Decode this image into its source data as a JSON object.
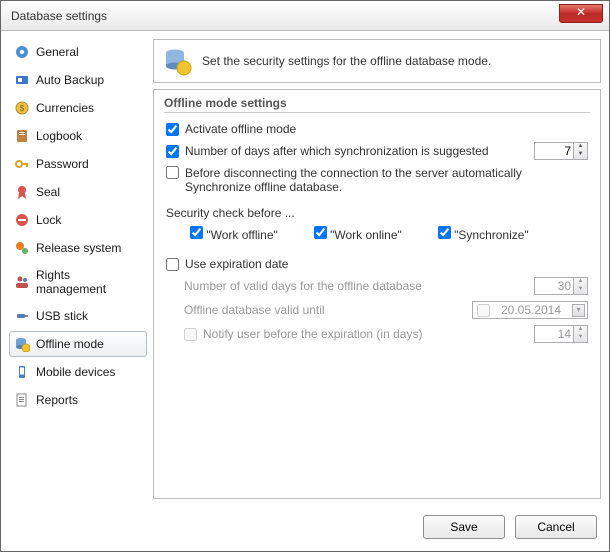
{
  "window": {
    "title": "Database settings",
    "close": "✕"
  },
  "sidebar": {
    "items": [
      {
        "label": "General"
      },
      {
        "label": "Auto Backup"
      },
      {
        "label": "Currencies"
      },
      {
        "label": "Logbook"
      },
      {
        "label": "Password"
      },
      {
        "label": "Seal"
      },
      {
        "label": "Lock"
      },
      {
        "label": "Release system"
      },
      {
        "label": "Rights management"
      },
      {
        "label": "USB stick"
      },
      {
        "label": "Offline mode"
      },
      {
        "label": "Mobile devices"
      },
      {
        "label": "Reports"
      }
    ],
    "selected_index": 10
  },
  "banner": {
    "text": "Set the security settings for the offline database mode."
  },
  "group": {
    "heading": "Offline mode settings",
    "activate": {
      "label": "Activate offline mode",
      "checked": true
    },
    "sync_days": {
      "label": "Number of days after which synchronization is suggested",
      "checked": true,
      "value": "7"
    },
    "before_disconnect": {
      "label_line1": "Before disconnecting the connection to the server automatically",
      "label_line2": "Synchronize offline database.",
      "checked": false
    },
    "security_heading": "Security check before ...",
    "security": {
      "work_offline": {
        "label": "\"Work offline\"",
        "checked": true
      },
      "work_online": {
        "label": "\"Work online\"",
        "checked": true
      },
      "synchronize": {
        "label": "\"Synchronize\"",
        "checked": true
      }
    },
    "expiration": {
      "use": {
        "label": "Use expiration date",
        "checked": false
      },
      "valid_days": {
        "label": "Number of valid days for the offline database",
        "value": "30"
      },
      "valid_until": {
        "label": "Offline database valid until",
        "date": "20.05.2014",
        "date_checked": false
      },
      "notify": {
        "label": "Notify user before the expiration (in days)",
        "checked": false,
        "value": "14"
      }
    }
  },
  "footer": {
    "save": "Save",
    "cancel": "Cancel"
  }
}
